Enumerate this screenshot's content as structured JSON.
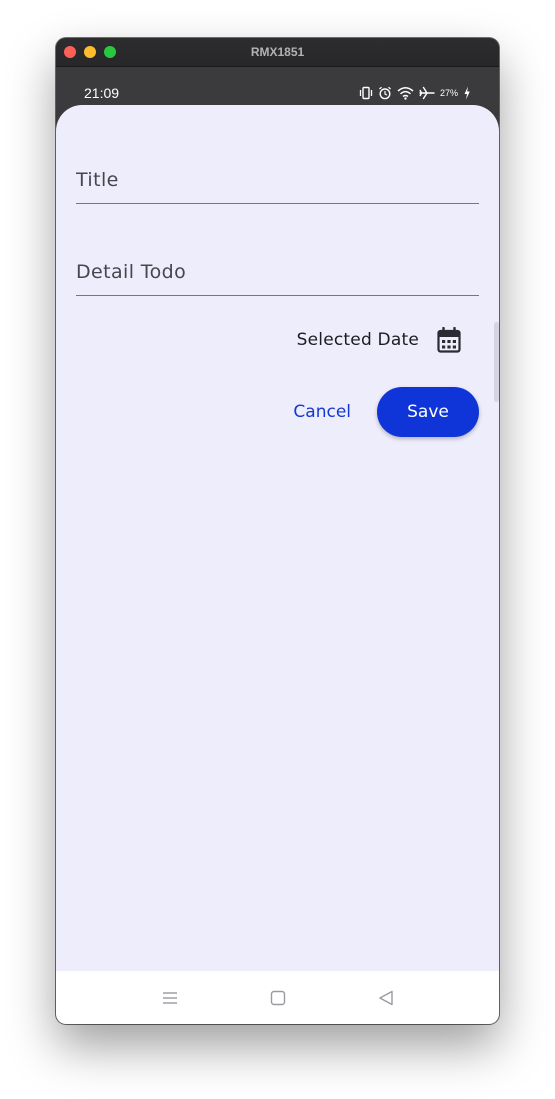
{
  "window": {
    "title": "RMX1851"
  },
  "status_bar": {
    "time": "21:09",
    "battery": "27%",
    "icons": [
      "vibrate-icon",
      "alarm-icon",
      "wifi-icon",
      "airplane-icon",
      "battery-charging-icon"
    ]
  },
  "form": {
    "title_placeholder": "Title",
    "detail_placeholder": "Detail Todo",
    "date_label": "Selected Date",
    "date_icon": "calendar-icon",
    "cancel_label": "Cancel",
    "save_label": "Save"
  },
  "nav": {
    "icons": [
      "recents-icon",
      "home-icon",
      "back-icon"
    ]
  },
  "colors": {
    "sheet_background": "#eeedfb",
    "accent": "#0f34d8",
    "cancel_text": "#1439d0"
  }
}
